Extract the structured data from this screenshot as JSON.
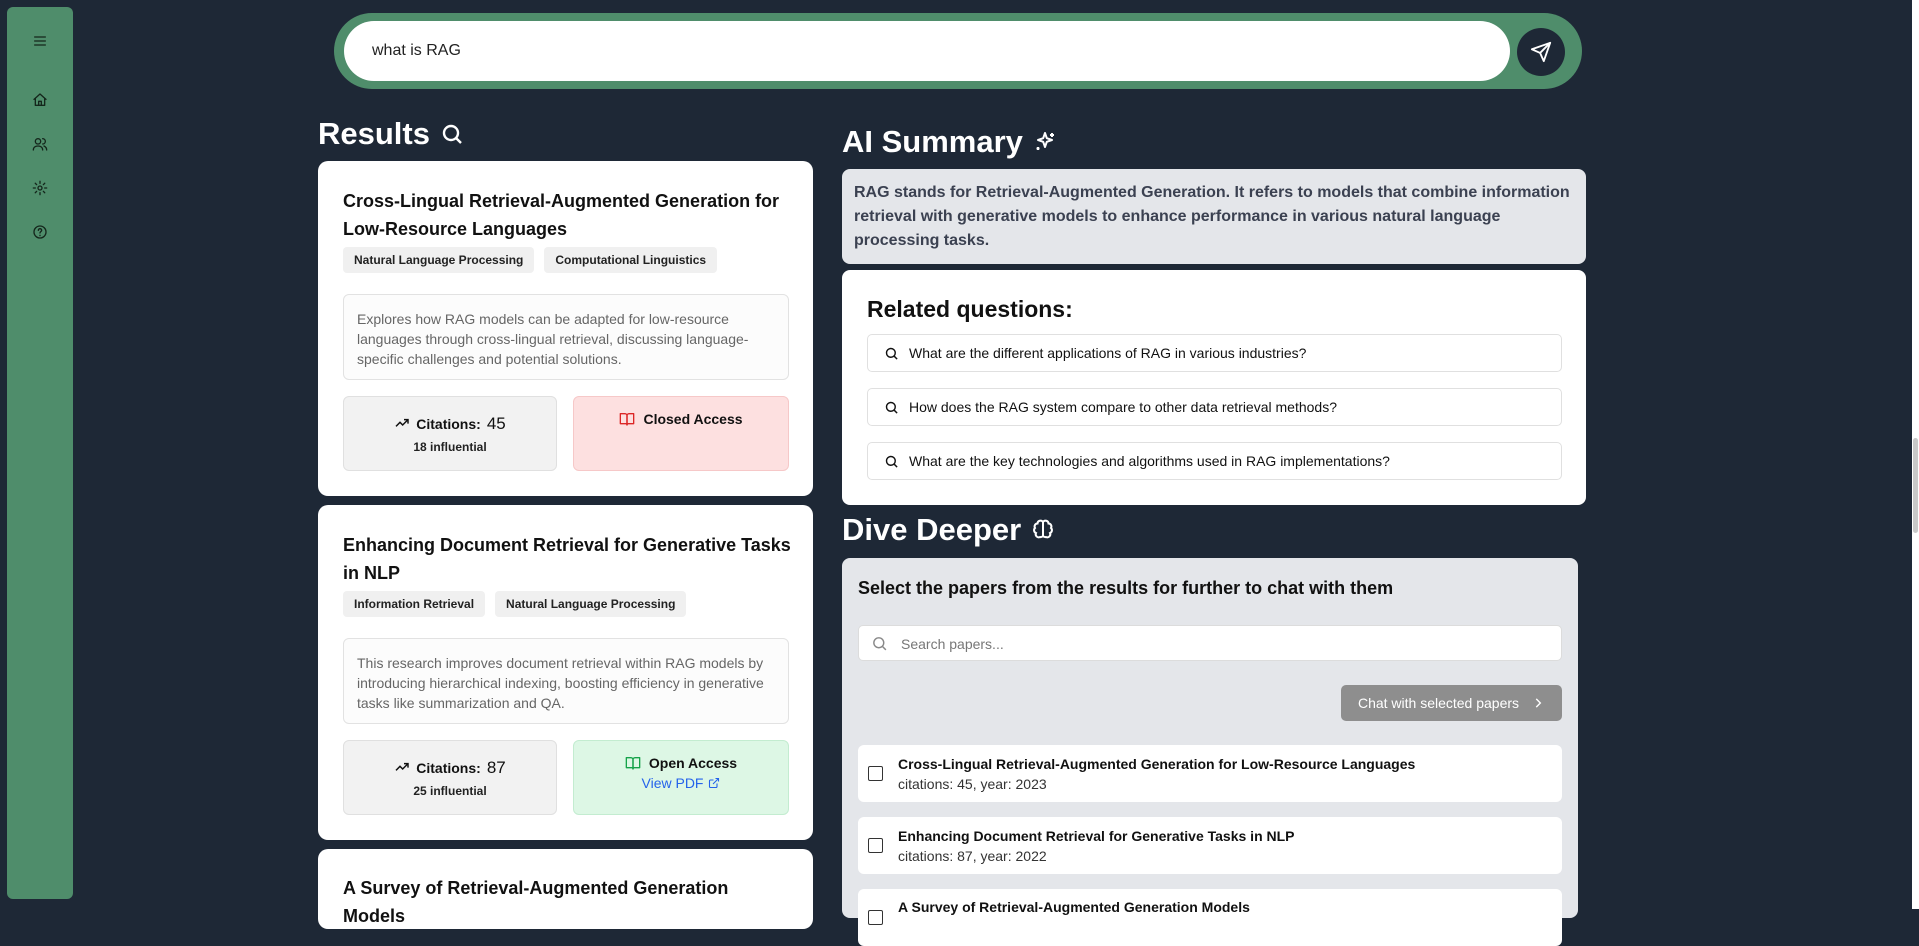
{
  "sidebar": {
    "icons": [
      "menu-icon",
      "home-icon",
      "users-icon",
      "settings-icon",
      "help-icon"
    ]
  },
  "search": {
    "value": "what is RAG"
  },
  "results": {
    "heading": "Results",
    "cards": [
      {
        "title": "Cross-Lingual Retrieval-Augmented Generation for Low-Resource Languages",
        "tags": [
          "Natural Language Processing",
          "Computational Linguistics"
        ],
        "abstract": "Explores how RAG models can be adapted for low-resource languages through cross-lingual retrieval, discussing language-specific challenges and potential solutions.",
        "citations_label": "Citations:",
        "citations": "45",
        "influential": "18 influential",
        "access": "Closed Access"
      },
      {
        "title": "Enhancing Document Retrieval for Generative Tasks in NLP",
        "tags": [
          "Information Retrieval",
          "Natural Language Processing"
        ],
        "abstract": "This research improves document retrieval within RAG models by introducing hierarchical indexing, boosting efficiency in generative tasks like summarization and QA.",
        "citations_label": "Citations:",
        "citations": "87",
        "influential": "25 influential",
        "access": "Open Access",
        "pdf_label": "View PDF"
      },
      {
        "title": "A Survey of Retrieval-Augmented Generation Models"
      }
    ]
  },
  "ai_summary": {
    "heading": "AI Summary",
    "text": "RAG stands for Retrieval-Augmented Generation. It refers to models that combine information retrieval with generative models to enhance performance in various natural language processing tasks."
  },
  "related": {
    "heading": "Related questions:",
    "questions": [
      "What are the different applications of RAG in various industries?",
      "How does the RAG system compare to other data retrieval methods?",
      "What are the key technologies and algorithms used in RAG implementations?"
    ]
  },
  "dive": {
    "heading": "Dive Deeper",
    "subheading": "Select the papers from the results for further to chat with them",
    "search_placeholder": "Search papers...",
    "chat_button": "Chat with selected papers",
    "papers": [
      {
        "title": "Cross-Lingual Retrieval-Augmented Generation for Low-Resource Languages",
        "meta": "citations: 45, year: 2023"
      },
      {
        "title": "Enhancing Document Retrieval for Generative Tasks in NLP",
        "meta": "citations: 87, year: 2022"
      },
      {
        "title": "A Survey of Retrieval-Augmented Generation Models",
        "meta": ""
      }
    ]
  },
  "colors": {
    "background": "#1e2836",
    "accent_green": "#4f8d6b",
    "closed_access_bg": "#fde0e0",
    "open_access_bg": "#ddf7e5",
    "link_blue": "#2563eb"
  }
}
